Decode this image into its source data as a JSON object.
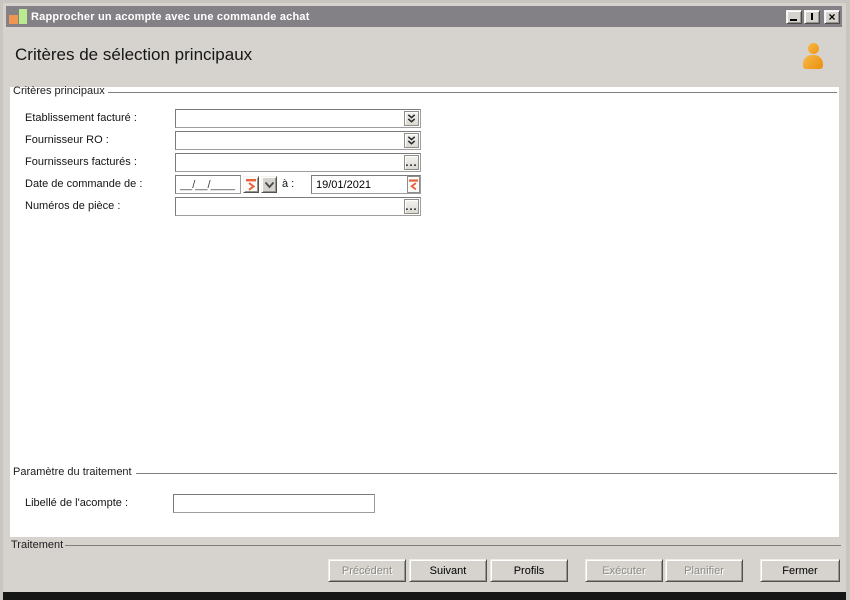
{
  "window": {
    "title": "Rapprocher un acompte avec une commande achat",
    "controls": {
      "close_glyph": "×"
    }
  },
  "header": {
    "title": "Critères de sélection principaux"
  },
  "groups": {
    "criteria": {
      "legend": "Critères principaux",
      "fields": [
        {
          "label": "Etablissement facturé :",
          "value": "",
          "control": "combo-double-chevron"
        },
        {
          "label": "Fournisseur RO :",
          "value": "",
          "control": "combo-double-chevron"
        },
        {
          "label": "Fournisseurs facturés :",
          "value": "",
          "control": "ellipsis-browse"
        },
        {
          "label": "Date de commande de :",
          "value": "__/__/____",
          "to_label": "à :",
          "to_value": "19/01/2021",
          "control": "date-range"
        },
        {
          "label": "Numéros de pièce :",
          "value": "",
          "control": "ellipsis-browse"
        }
      ]
    },
    "params": {
      "legend": "Paramètre du traitement",
      "field": {
        "label": "Libellé de l'acompte :",
        "value": ""
      }
    },
    "treatment": {
      "legend": "Traitement"
    }
  },
  "buttons": [
    {
      "label": "Précédent",
      "enabled": false
    },
    {
      "label": "Suivant",
      "enabled": true
    },
    {
      "label": "Profils",
      "enabled": true
    },
    {
      "label": "Exécuter",
      "enabled": false
    },
    {
      "label": "Planifier",
      "enabled": false
    },
    {
      "label": "Fermer",
      "enabled": true
    }
  ],
  "icons": {
    "title_bar": "bar-chart-icon",
    "header_right": "user-icon",
    "combo_buttons": "double-chevron-down-icon",
    "date_first": "date-next-icon",
    "date_dropdown": "chevron-down-icon",
    "date_second": "date-prev-icon",
    "browse_buttons": "ellipsis-icon"
  },
  "colors": {
    "titlebar": "#838185",
    "background": "#d6d3ce",
    "panel": "#ffffff",
    "accent_orange": "#e8623d",
    "icon_orange": "#f09a3c",
    "icon_green": "#b9ea8e",
    "bottom_edge": "#151515"
  }
}
